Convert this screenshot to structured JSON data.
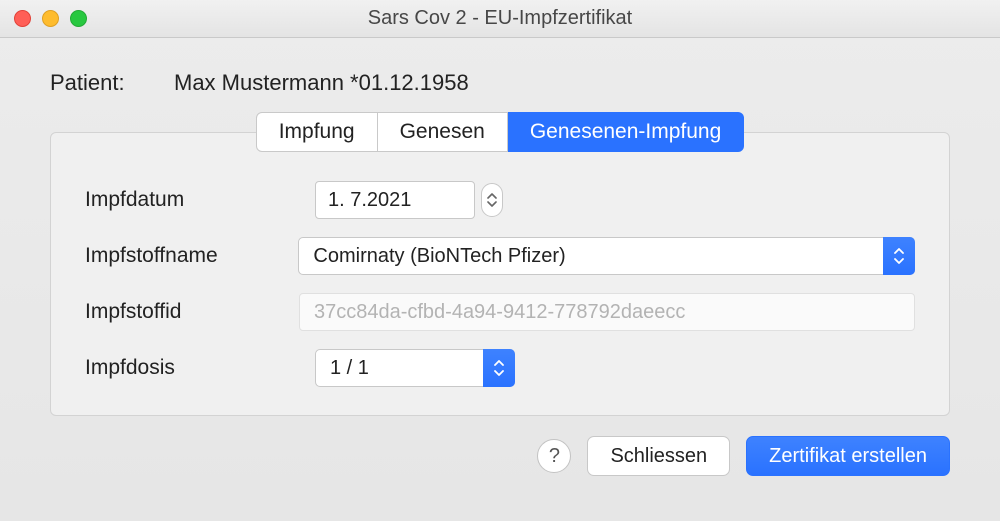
{
  "window": {
    "title": "Sars Cov 2 - EU-Impfzertifikat"
  },
  "patient": {
    "label": "Patient:",
    "name": "Max Mustermann *01.12.1958"
  },
  "tabs": {
    "impfung": "Impfung",
    "genesen": "Genesen",
    "genesenen_impfung": "Genesenen-Impfung"
  },
  "form": {
    "impfdatum": {
      "label": "Impfdatum",
      "value": "1.  7.2021"
    },
    "impfstoffname": {
      "label": "Impfstoffname",
      "value": "Comirnaty (BioNTech Pfizer)"
    },
    "impfstoffid": {
      "label": "Impfstoffid",
      "value": "37cc84da-cfbd-4a94-9412-778792daeecc"
    },
    "impfdosis": {
      "label": "Impfdosis",
      "value": "1 / 1"
    }
  },
  "buttons": {
    "help": "?",
    "close": "Schliessen",
    "create": "Zertifikat erstellen"
  }
}
